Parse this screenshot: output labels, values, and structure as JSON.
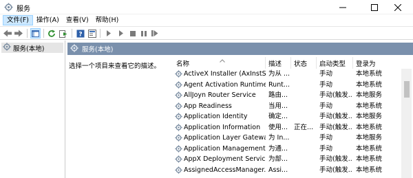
{
  "window": {
    "title": "服务"
  },
  "menu": [
    {
      "label": "文件(F)",
      "active": true
    },
    {
      "label": "操作(A)",
      "active": false
    },
    {
      "label": "查看(V)",
      "active": false
    },
    {
      "label": "帮助(H)",
      "active": false
    }
  ],
  "toolbar": {
    "icons": [
      "back-arrow-icon",
      "forward-arrow-icon",
      "show-hide-tree-icon",
      "refresh-icon",
      "export-list-icon",
      "help-icon",
      "properties-icon",
      "start-icon",
      "start-alt-icon",
      "stop-icon",
      "pause-icon",
      "restart-icon"
    ]
  },
  "tree": {
    "selected": "服务(本地)"
  },
  "pane": {
    "header": "服务(本地)",
    "description": "选择一个项目来查看它的描述。"
  },
  "list": {
    "columns": [
      "名称",
      "描述",
      "状态",
      "启动类型",
      "登录为"
    ],
    "rows": [
      {
        "name": "ActiveX Installer (AxInstSV)",
        "desc": "为从 ...",
        "status": "",
        "startup": "手动",
        "logon": "本地系统"
      },
      {
        "name": "Agent Activation Runtime...",
        "desc": "Runt...",
        "status": "",
        "startup": "手动",
        "logon": "本地系统"
      },
      {
        "name": "AllJoyn Router Service",
        "desc": "路由...",
        "status": "",
        "startup": "手动(触发...",
        "logon": "本地服务"
      },
      {
        "name": "App Readiness",
        "desc": "当用...",
        "status": "",
        "startup": "手动",
        "logon": "本地系统"
      },
      {
        "name": "Application Identity",
        "desc": "确定...",
        "status": "",
        "startup": "手动(触发...",
        "logon": "本地服务"
      },
      {
        "name": "Application Information",
        "desc": "使用...",
        "status": "正在...",
        "startup": "手动(触发...",
        "logon": "本地系统"
      },
      {
        "name": "Application Layer Gatewa...",
        "desc": "为 In...",
        "status": "",
        "startup": "手动",
        "logon": "本地服务"
      },
      {
        "name": "Application Management",
        "desc": "为通...",
        "status": "",
        "startup": "手动",
        "logon": "本地系统"
      },
      {
        "name": "AppX Deployment Servic...",
        "desc": "为部...",
        "status": "",
        "startup": "手动(触发...",
        "logon": "本地系统"
      },
      {
        "name": "AssignedAccessManager...",
        "desc": "Assi...",
        "status": "",
        "startup": "手动(触发...",
        "logon": "本地系统"
      }
    ]
  },
  "colors": {
    "pane_header_bg": "#7a90ac",
    "menu_active_bg": "#cce8ff",
    "tree_selected_bg": "#e5e5e5"
  }
}
